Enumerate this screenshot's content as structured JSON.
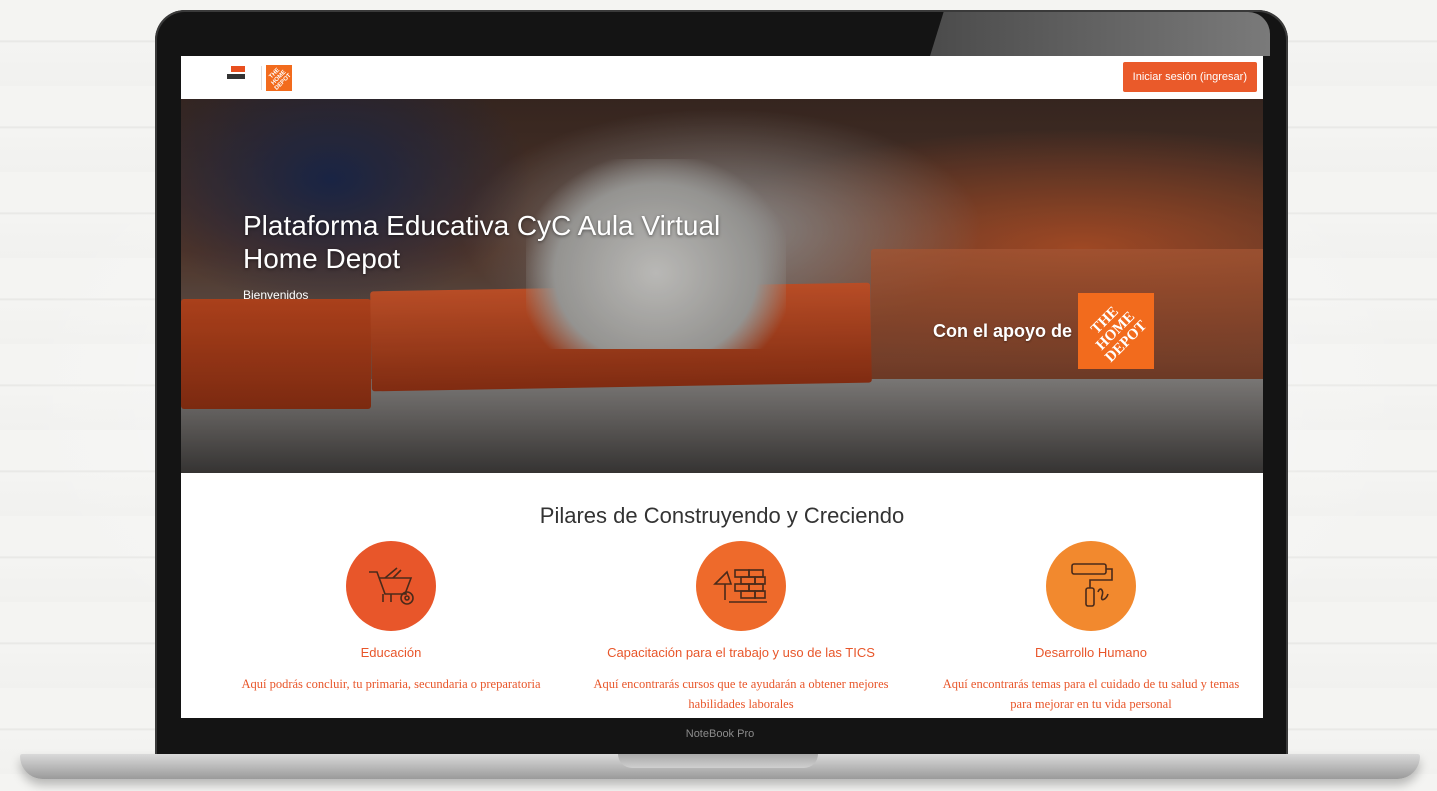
{
  "device": {
    "model_label": "NoteBook Pro"
  },
  "header": {
    "logo_hd_text": "THE HOME DEPOT",
    "login_button": "Iniciar sesión (ingresar)"
  },
  "hero": {
    "title": "Plataforma Educativa CyC Aula Virtual Home Depot",
    "subtitle": "Bienvenidos",
    "support_text": "Con el apoyo de",
    "support_logo_text": "THE HOME DEPOT"
  },
  "pillars": {
    "heading": "Pilares de Construyendo y Creciendo",
    "items": [
      {
        "icon": "wheelbarrow-icon",
        "color": "#e8562a",
        "title": "Educación",
        "description": "Aquí podrás concluir, tu primaria, secundaria o preparatoria"
      },
      {
        "icon": "trowel-bricks-icon",
        "color": "#ee6a2b",
        "title": "Capacitación para el trabajo y uso de las TICS",
        "description": "Aquí encontrarás cursos que te ayudarán a obtener mejores habilidades laborales"
      },
      {
        "icon": "paint-roller-icon",
        "color": "#f2892e",
        "title": "Desarrollo Humano",
        "description": "Aquí encontrarás temas para el cuidado de tu salud y temas para mejorar en tu vida personal"
      }
    ]
  },
  "colors": {
    "accent": "#ea5a2a",
    "brand_orange": "#f26b1d"
  }
}
